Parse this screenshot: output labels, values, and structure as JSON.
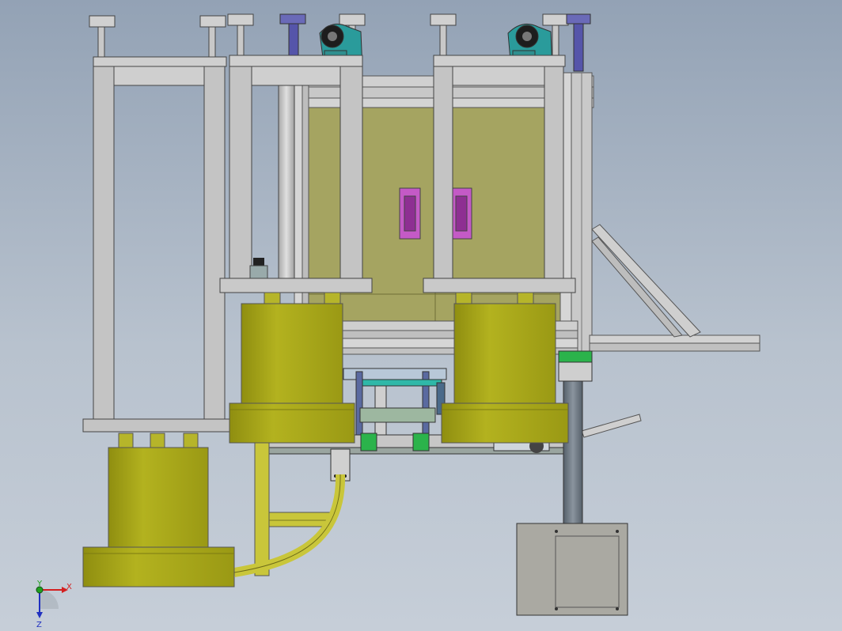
{
  "viewport": {
    "background_top": "#93a2b5",
    "background_bottom": "#c6ced8"
  },
  "model_colors": {
    "frame_gray": "#c4c4c4",
    "tank_yellow": "#a7a619",
    "panel_khaki": "#a5a461",
    "window_magenta": "#c45ac6",
    "motor_teal": "#2a9b9b",
    "knob_blue": "#5555aa",
    "terminal_green": "#2bb34b",
    "base_box": "#aaa9a2"
  },
  "triad": {
    "x_label": "X",
    "y_label": "Y",
    "z_label": "Z",
    "x_color": "#d42020",
    "y_color": "#20a020",
    "z_color": "#2030c0"
  }
}
